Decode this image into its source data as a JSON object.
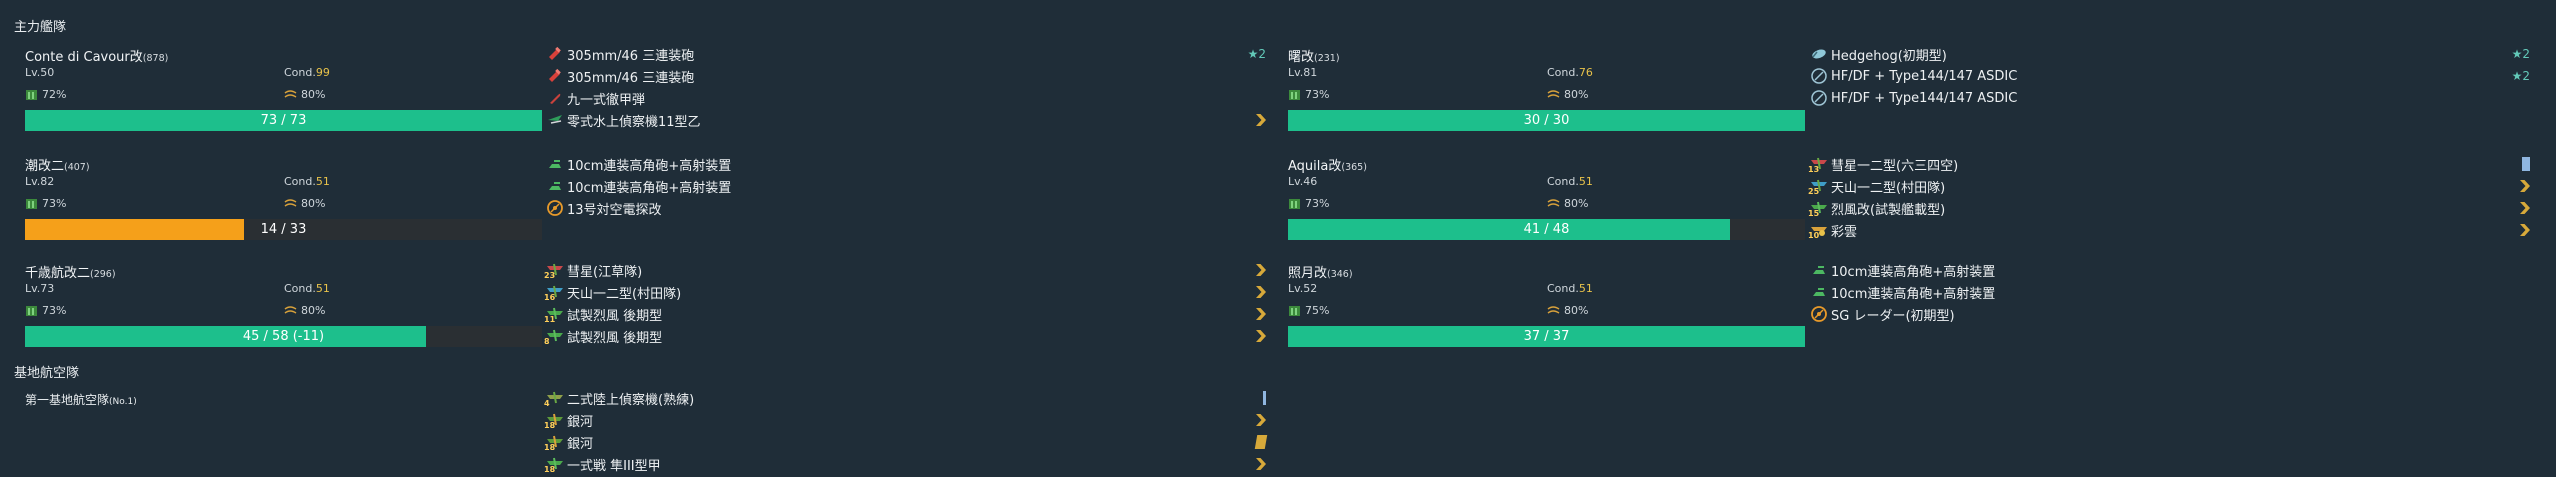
{
  "fleet_title": "主力艦隊",
  "base_title": "基地航空隊",
  "colors": {
    "hp_green": "#1dbf8c",
    "hp_orange": "#f5a01a",
    "cond_yellow": "#e8c24a",
    "star": "#62c9b8"
  },
  "ships": [
    {
      "name": "Conte di Cavour改",
      "id": "(878)",
      "lv": "Lv.50",
      "cond_label": "Cond.",
      "cond": "99",
      "fuel": "72%",
      "ammo": "80%",
      "hp": "73 / 73",
      "hp_ratio": 1.0,
      "hp_state": "green"
    },
    {
      "name": "曙改",
      "id": "(231)",
      "lv": "Lv.81",
      "cond_label": "Cond.",
      "cond": "76",
      "fuel": "73%",
      "ammo": "80%",
      "hp": "30 / 30",
      "hp_ratio": 1.0,
      "hp_state": "green"
    },
    {
      "name": "潮改二",
      "id": "(407)",
      "lv": "Lv.82",
      "cond_label": "Cond.",
      "cond": "51",
      "fuel": "73%",
      "ammo": "80%",
      "hp": "14 / 33",
      "hp_ratio": 0.424,
      "hp_state": "orange"
    },
    {
      "name": "Aquila改",
      "id": "(365)",
      "lv": "Lv.46",
      "cond_label": "Cond.",
      "cond": "51",
      "fuel": "73%",
      "ammo": "80%",
      "hp": "41 / 48",
      "hp_ratio": 0.854,
      "hp_state": "green"
    },
    {
      "name": "千歳航改二",
      "id": "(296)",
      "lv": "Lv.73",
      "cond_label": "Cond.",
      "cond": "51",
      "fuel": "73%",
      "ammo": "80%",
      "hp": "45 / 58 (-11)",
      "hp_ratio": 0.776,
      "hp_state": "green"
    },
    {
      "name": "照月改",
      "id": "(346)",
      "lv": "Lv.52",
      "cond_label": "Cond.",
      "cond": "51",
      "fuel": "75%",
      "ammo": "80%",
      "hp": "37 / 37",
      "hp_ratio": 1.0,
      "hp_state": "green"
    }
  ],
  "equipment": [
    [
      {
        "icon": "main-gun-red",
        "name": "305mm/46 三連装砲",
        "right": "★2"
      },
      {
        "icon": "main-gun-red",
        "name": "305mm/46 三連装砲",
        "right": ""
      },
      {
        "icon": "ap-shell",
        "name": "九一式徹甲弾",
        "right": ""
      },
      {
        "icon": "seaplane",
        "name": "零式水上偵察機11型乙",
        "right": "chevron"
      }
    ],
    [
      {
        "icon": "depth-charge",
        "name": "Hedgehog(初期型)",
        "right": "★2"
      },
      {
        "icon": "sonar",
        "name": "HF/DF + Type144/147 ASDIC",
        "right": "★2"
      },
      {
        "icon": "sonar",
        "name": "HF/DF + Type144/147 ASDIC",
        "right": ""
      }
    ],
    [
      {
        "icon": "sec-gun-green",
        "name": "10cm連装高角砲+高射装置",
        "right": ""
      },
      {
        "icon": "sec-gun-green",
        "name": "10cm連装高角砲+高射装置",
        "right": ""
      },
      {
        "icon": "aa-radar",
        "name": "13号対空電探改",
        "right": ""
      }
    ],
    [
      {
        "icon": "dive-bomber",
        "count": "13",
        "name": "彗星一二型(六三四空)",
        "right": "bar"
      },
      {
        "icon": "torpedo-bomber",
        "count": "25",
        "name": "天山一二型(村田隊)",
        "right": "chevron"
      },
      {
        "icon": "fighter",
        "count": "15",
        "name": "烈風改(試製艦載型)",
        "right": "chevron"
      },
      {
        "icon": "recon",
        "count": "10",
        "name": "彩雲",
        "right": "chevron"
      }
    ],
    [
      {
        "icon": "dive-bomber",
        "count": "23",
        "name": "彗星(江草隊)",
        "right": "chevron"
      },
      {
        "icon": "torpedo-bomber",
        "count": "16",
        "name": "天山一二型(村田隊)",
        "right": "chevron"
      },
      {
        "icon": "fighter",
        "count": "11",
        "name": "試製烈風 後期型",
        "right": "chevron"
      },
      {
        "icon": "fighter",
        "count": "8",
        "name": "試製烈風 後期型",
        "right": "chevron"
      }
    ],
    [
      {
        "icon": "sec-gun-green",
        "name": "10cm連装高角砲+高射装置",
        "right": ""
      },
      {
        "icon": "sec-gun-green",
        "name": "10cm連装高角砲+高射装置",
        "right": ""
      },
      {
        "icon": "aa-radar",
        "name": "SG レーダー(初期型)",
        "right": ""
      }
    ]
  ],
  "base": {
    "name": "第一基地航空隊",
    "id": "(No.1)",
    "equipment": [
      {
        "icon": "land-recon",
        "count": "4",
        "name": "二式陸上偵察機(熟練)",
        "right": "thinbar"
      },
      {
        "icon": "land-bomber",
        "count": "18",
        "name": "銀河",
        "right": "chevron"
      },
      {
        "icon": "land-bomber",
        "count": "18",
        "name": "銀河",
        "right": "widebar"
      },
      {
        "icon": "fighter",
        "count": "18",
        "name": "一式戦 隼III型甲",
        "right": "chevron"
      }
    ]
  }
}
